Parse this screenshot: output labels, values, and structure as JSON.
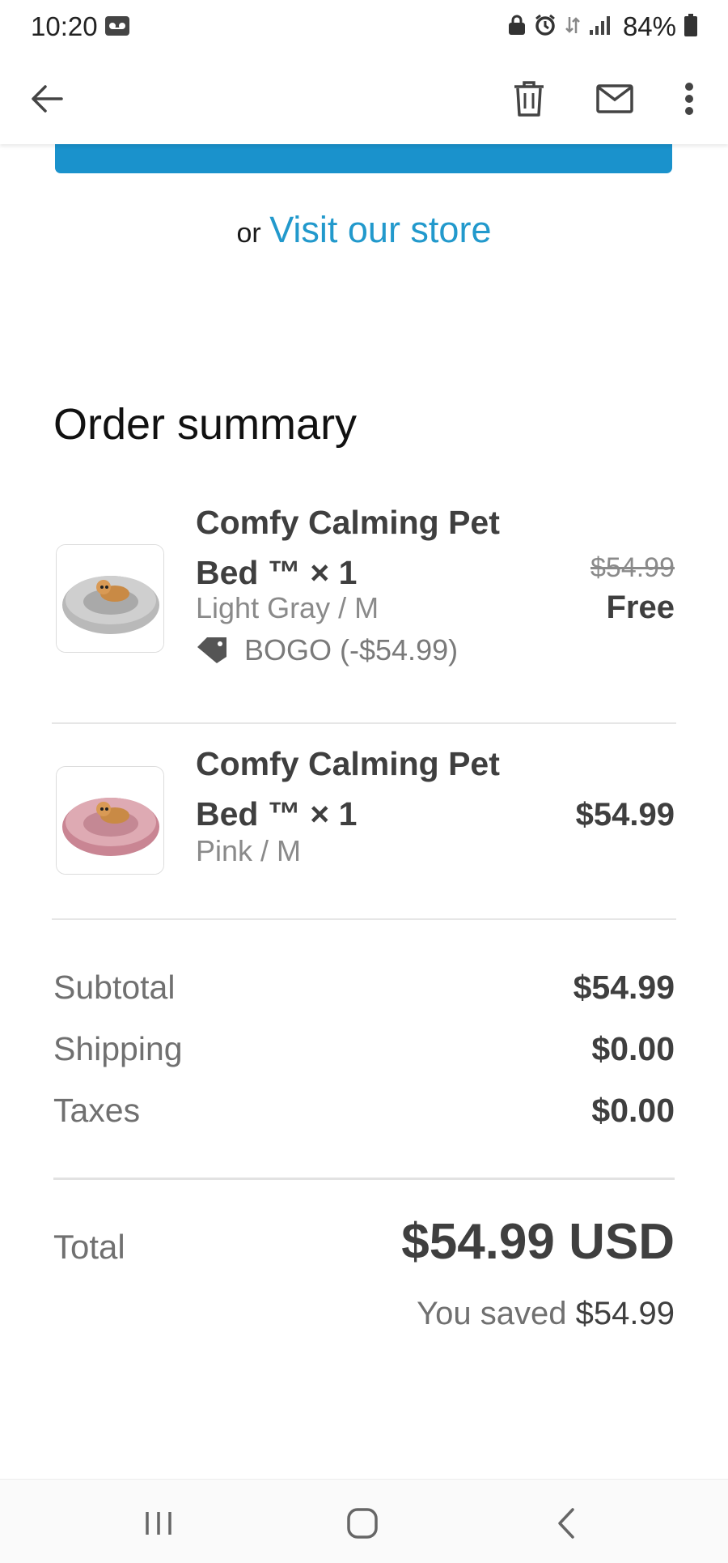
{
  "status_bar": {
    "time": "10:20",
    "battery": "84%"
  },
  "app_bar": {
    "icons": [
      "arrow-back-icon",
      "delete-icon",
      "mail-icon",
      "more-vert-icon"
    ]
  },
  "store_link": {
    "or_text": "or",
    "link_text": "Visit our store"
  },
  "order_summary": {
    "title": "Order summary",
    "items": [
      {
        "name": "Comfy Calming Pet Bed ™ × 1",
        "variant": "Light Gray / M",
        "discount": "BOGO (-$54.99)",
        "original_price": "$54.99",
        "price": "Free"
      },
      {
        "name": "Comfy Calming Pet Bed ™ × 1",
        "variant": "Pink / M",
        "price": "$54.99"
      }
    ],
    "subtotal_label": "Subtotal",
    "subtotal_value": "$54.99",
    "shipping_label": "Shipping",
    "shipping_value": "$0.00",
    "taxes_label": "Taxes",
    "taxes_value": "$0.00",
    "total_label": "Total",
    "total_value": "$54.99 USD",
    "saved_prefix": "You saved",
    "saved_amount": "$54.99"
  },
  "colors": {
    "accent": "#1a92cc",
    "link": "#2299cc",
    "gray_bed": "#c4c4c4",
    "pink_bed": "#d9a0ab"
  }
}
